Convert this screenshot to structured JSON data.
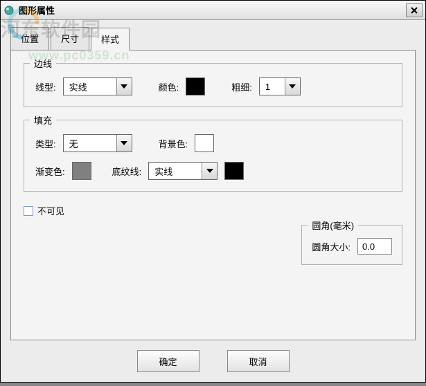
{
  "window": {
    "title": "图形属性"
  },
  "watermark": {
    "text": "河东软件园",
    "url": "www.pc0359.cn"
  },
  "tabs": [
    {
      "label": "位置"
    },
    {
      "label": "尺寸"
    },
    {
      "label": "样式"
    }
  ],
  "border": {
    "legend": "边线",
    "lineTypeLabel": "线型:",
    "lineTypeValue": "实线",
    "colorLabel": "颜色:",
    "colorValue": "#000000",
    "weightLabel": "粗细:",
    "weightValue": "1"
  },
  "fill": {
    "legend": "填充",
    "typeLabel": "类型:",
    "typeValue": "无",
    "bgColorLabel": "背景色:",
    "bgColorValue": "#ffffff",
    "gradientLabel": "渐变色:",
    "gradientValue": "#808080",
    "hatchLineLabel": "底纹线:",
    "hatchLineValue": "实线",
    "hatchColorValue": "#000000"
  },
  "invisible": {
    "label": "不可见"
  },
  "corner": {
    "legend": "圆角(毫米)",
    "label": "圆角大小:",
    "value": "0.0"
  },
  "buttons": {
    "ok": "确定",
    "cancel": "取消"
  }
}
